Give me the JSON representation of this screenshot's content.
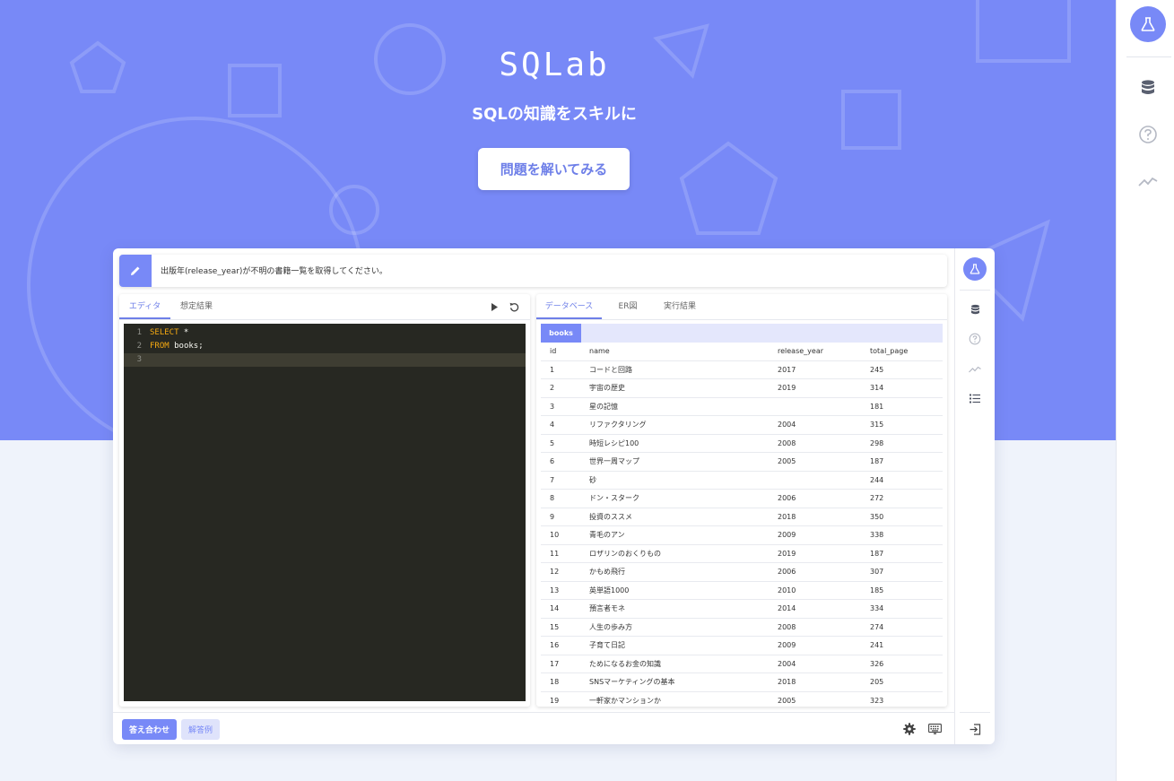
{
  "hero": {
    "logo": "SQLab",
    "tagline": "SQLの知識をスキルに",
    "cta_label": "問題を解いてみる"
  },
  "right_sidebar": {
    "icons": [
      "flask-icon",
      "database-icon",
      "help-icon",
      "chart-line-icon"
    ]
  },
  "question": {
    "text": "出版年(release_year)が不明の書籍一覧を取得してください。"
  },
  "editor": {
    "tabs": [
      {
        "label": "エディタ",
        "active": true
      },
      {
        "label": "想定結果",
        "active": false
      }
    ],
    "lines": [
      {
        "num": "1",
        "keyword": "SELECT",
        "rest": " *"
      },
      {
        "num": "2",
        "keyword": "FROM",
        "rest": " books;"
      },
      {
        "num": "3",
        "keyword": "",
        "rest": ""
      }
    ]
  },
  "database": {
    "tabs": [
      {
        "label": "データベース",
        "active": true
      },
      {
        "label": "ER図",
        "active": false
      },
      {
        "label": "実行結果",
        "active": false
      }
    ],
    "table_name": "books",
    "columns": [
      "id",
      "name",
      "release_year",
      "total_page"
    ],
    "rows": [
      [
        "1",
        "コードと回路",
        "2017",
        "245"
      ],
      [
        "2",
        "宇宙の歴史",
        "2019",
        "314"
      ],
      [
        "3",
        "星の記憶",
        "",
        "181"
      ],
      [
        "4",
        "リファクタリング",
        "2004",
        "315"
      ],
      [
        "5",
        "時短レシピ100",
        "2008",
        "298"
      ],
      [
        "6",
        "世界一周マップ",
        "2005",
        "187"
      ],
      [
        "7",
        "砂",
        "",
        "244"
      ],
      [
        "8",
        "ドン・スターク",
        "2006",
        "272"
      ],
      [
        "9",
        "投資のススメ",
        "2018",
        "350"
      ],
      [
        "10",
        "青毛のアン",
        "2009",
        "338"
      ],
      [
        "11",
        "ロザリンのおくりもの",
        "2019",
        "187"
      ],
      [
        "12",
        "かもめ飛行",
        "2006",
        "307"
      ],
      [
        "13",
        "英単語1000",
        "2010",
        "185"
      ],
      [
        "14",
        "預言者モネ",
        "2014",
        "334"
      ],
      [
        "15",
        "人生の歩み方",
        "2008",
        "274"
      ],
      [
        "16",
        "子育て日記",
        "2009",
        "241"
      ],
      [
        "17",
        "ためになるお金の知識",
        "2004",
        "326"
      ],
      [
        "18",
        "SNSマーケティングの基本",
        "2018",
        "205"
      ],
      [
        "19",
        "一軒家かマンションか",
        "2005",
        "323"
      ]
    ]
  },
  "bottom": {
    "check_label": "答え合わせ",
    "answer_label": "解答例"
  },
  "colors": {
    "accent": "#7889f7",
    "editor_bg": "#272822",
    "keyword": "#f6aa11"
  }
}
